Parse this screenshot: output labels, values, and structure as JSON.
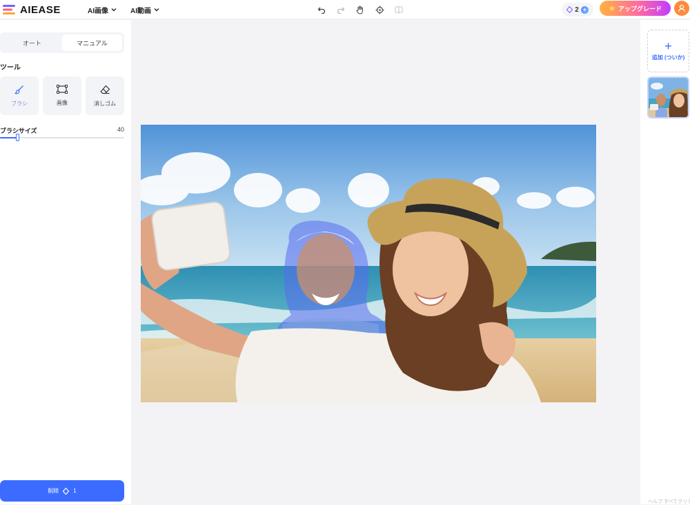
{
  "header": {
    "logo_text": "AIEASE",
    "nav": [
      {
        "label": "AI画像"
      },
      {
        "label": "AI動画"
      }
    ],
    "credits_count": "2",
    "upgrade_label": "アップグレード"
  },
  "sidebar": {
    "mode_tabs": [
      {
        "label": "オート",
        "active": false
      },
      {
        "label": "マニュアル",
        "active": true
      }
    ],
    "tools_title": "ツール",
    "tools": [
      {
        "label": "ブラシ",
        "icon": "brush-icon",
        "active": true
      },
      {
        "label": "画像",
        "icon": "rectangle-select-icon",
        "active": false
      },
      {
        "label": "消しゴム",
        "icon": "eraser-icon",
        "active": false
      }
    ],
    "brush_size_label": "ブラシサイズ",
    "brush_size_value": "40",
    "brush_size_fraction": 0.14,
    "remove_button_label": "削除",
    "remove_button_cost": "1"
  },
  "right_panel": {
    "add_label": "追加 (ついか)"
  },
  "footer": {
    "text": "ヘルプ すべてクリア"
  },
  "colors": {
    "accent": "#3b6cff",
    "selection_overlay": "#5a6cf0"
  }
}
